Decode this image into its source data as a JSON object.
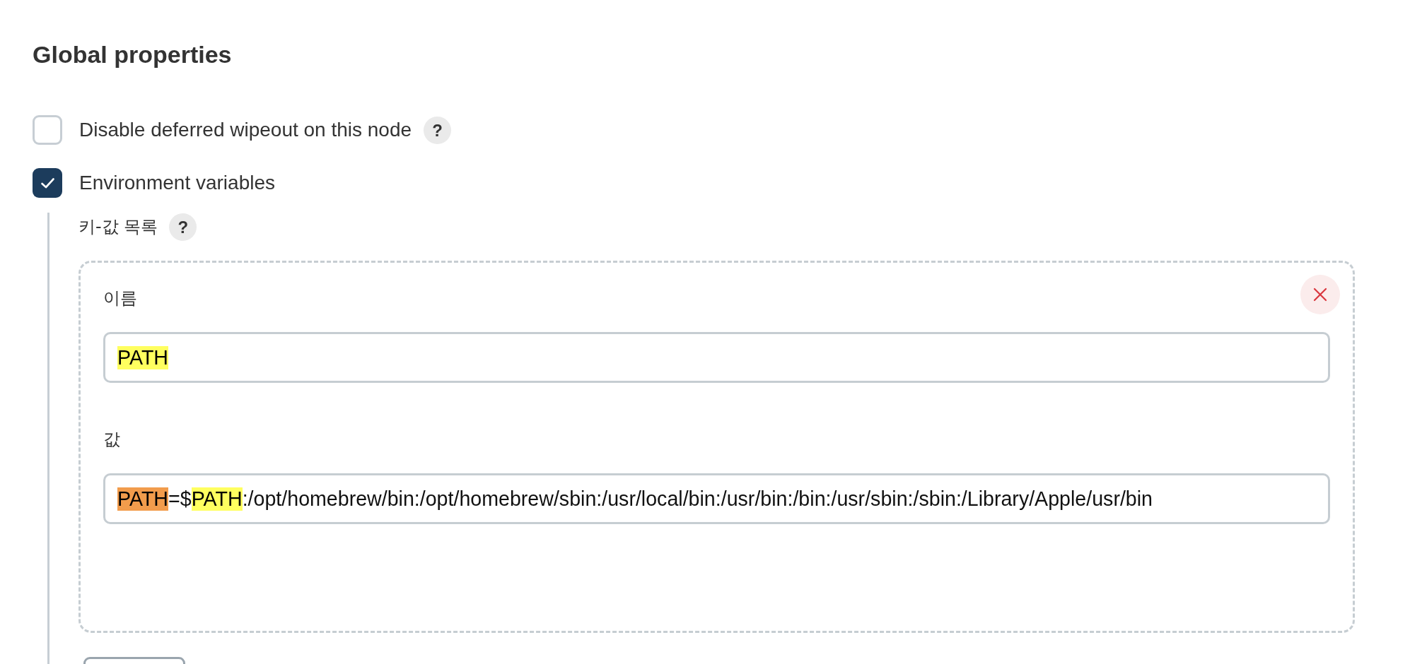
{
  "section": {
    "title": "Global properties"
  },
  "options": [
    {
      "label": "Disable deferred wipeout on this node",
      "checked": false,
      "help": "?"
    },
    {
      "label": "Environment variables",
      "checked": true,
      "details": {
        "label": "키-값 목록",
        "help": "?",
        "entries": [
          {
            "fields": [
              {
                "label": "이름",
                "segments": [
                  {
                    "text": "PATH",
                    "kind": "match"
                  }
                ]
              },
              {
                "label": "값",
                "segments": [
                  {
                    "text": "PATH",
                    "kind": "current-match"
                  },
                  {
                    "text": "=$",
                    "kind": "plain"
                  },
                  {
                    "text": "PATH",
                    "kind": "match"
                  },
                  {
                    "text": ":/opt/homebrew/bin:/opt/homebrew/sbin:/usr/local/bin:/usr/bin:/bin:/usr/sbin:/sbin:/Library/Apple/usr/bin",
                    "kind": "plain"
                  }
                ]
              }
            ]
          }
        ]
      }
    }
  ]
}
